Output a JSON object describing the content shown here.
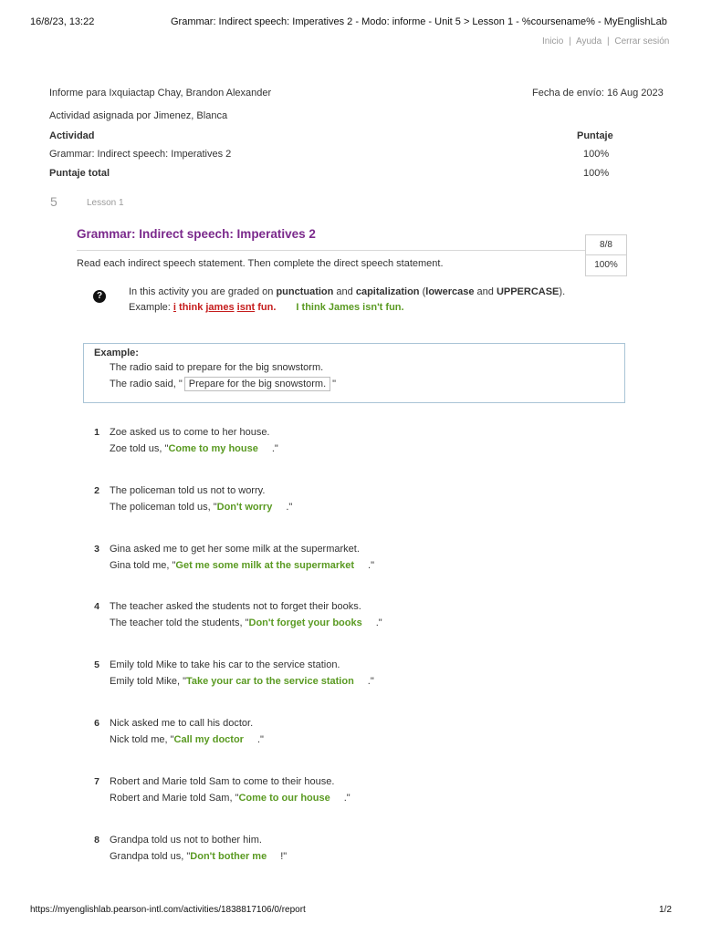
{
  "print_header": {
    "datetime": "16/8/23, 13:22",
    "page_title": "Grammar: Indirect speech: Imperatives 2 - Modo: informe - Unit 5 > Lesson 1 - %coursename% - MyEnglishLab"
  },
  "top_links": {
    "home": "Inicio",
    "sep1": "|",
    "help": "Ayuda",
    "sep2": "|",
    "logout": "Cerrar sesión"
  },
  "report": {
    "for_label": "Informe para Ixquiactap Chay, Brandon Alexander",
    "sent_label": "Fecha de envío: 16 Aug 2023",
    "assigned_by": "Actividad asignada por Jimenez, Blanca",
    "col_activity": "Actividad",
    "col_score": "Puntaje",
    "activity_name": "Grammar: Indirect speech: Imperatives 2",
    "activity_score": "100%",
    "total_label": "Puntaje total",
    "total_score": "100%"
  },
  "lesson": {
    "unit_number": "5",
    "lesson_label": "Lesson 1"
  },
  "activity": {
    "title": "Grammar: Indirect speech: Imperatives 2",
    "score_fraction": "8/8",
    "score_percent": "100%",
    "instructions": "Read each indirect speech statement. Then complete the direct speech statement.",
    "note_pre": "In this activity you are graded on ",
    "note_punct": "punctuation",
    "note_and1": " and ",
    "note_cap": "capitalization",
    "note_paren_open": " (",
    "note_lower": "lowercase",
    "note_and2": " and ",
    "note_upper": "UPPERCASE",
    "note_paren_close": ").",
    "example_prefix": "Example: ",
    "wrong_i": "i",
    "wrong_think": " think ",
    "wrong_james": "james",
    "wrong_space": " ",
    "wrong_isnt": "isnt",
    "wrong_fun": " fun.",
    "right_example": "I think James isn't fun."
  },
  "example": {
    "label": "Example:",
    "indirect": "The radio said to prepare for the big snowstorm.",
    "direct_prefix": "The radio said, \"",
    "direct_answer": "Prepare for the big snowstorm.",
    "direct_suffix": "\""
  },
  "questions": [
    {
      "num": "1",
      "indirect": "Zoe asked us to come to her house.",
      "prefix": "Zoe told us, \"",
      "answer": "Come to my house",
      "suffix": ".\""
    },
    {
      "num": "2",
      "indirect": "The policeman told us not to worry.",
      "prefix": "The policeman told us, \"",
      "answer": "Don't worry",
      "suffix": ".\""
    },
    {
      "num": "3",
      "indirect": "Gina asked me to get her some milk at the supermarket.",
      "prefix": "Gina told me, \"",
      "answer": "Get me some milk at the supermarket",
      "suffix": ".\""
    },
    {
      "num": "4",
      "indirect": "The teacher asked the students not to forget their books.",
      "prefix": "The teacher told the students, \"",
      "answer": "Don't forget your books",
      "suffix": ".\""
    },
    {
      "num": "5",
      "indirect": "Emily told Mike to take his car to the service station.",
      "prefix": "Emily told Mike, \"",
      "answer": "Take your car to the service station",
      "suffix": ".\""
    },
    {
      "num": "6",
      "indirect": "Nick asked me to call his doctor.",
      "prefix": "Nick told me, \"",
      "answer": "Call my doctor",
      "suffix": ".\""
    },
    {
      "num": "7",
      "indirect": "Robert and Marie told Sam to come to their house.",
      "prefix": "Robert and Marie told Sam, \"",
      "answer": "Come to our house",
      "suffix": ".\""
    },
    {
      "num": "8",
      "indirect": "Grandpa told us not to bother him.",
      "prefix": "Grandpa told us, \"",
      "answer": "Don't bother me",
      "suffix": "!\""
    }
  ],
  "print_footer": {
    "url": "https://myenglishlab.pearson-intl.com/activities/1838817106/0/report",
    "page": "1/2"
  },
  "colors": {
    "title": "#7b2a8c",
    "answer_green": "#5a9a22",
    "error_red": "#c51c1c",
    "example_border": "#a9c4d6"
  }
}
